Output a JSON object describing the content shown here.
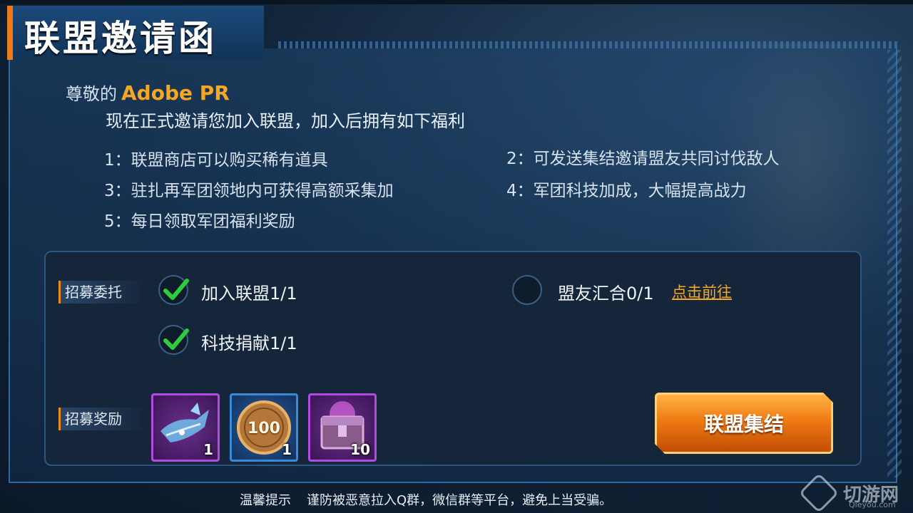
{
  "title": "联盟邀请函",
  "greeting": {
    "label": "尊敬的",
    "name": "Adobe PR"
  },
  "invite_line": "现在正式邀请您加入联盟，加入后拥有如下福利",
  "benefits": [
    "1：联盟商店可以购买稀有道具",
    "2：可发送集结邀请盟友共同讨伐敌人",
    "3：驻扎再军团领地内可获得高额采集加",
    "4：军团科技加成，大幅提高战力",
    "5：每日领取军团福利奖励"
  ],
  "tasks": {
    "section_label": "招募委托",
    "items": [
      {
        "label": "加入联盟1/1",
        "done": true
      },
      {
        "label": "盟友汇合0/1",
        "done": false,
        "link": "点击前往"
      },
      {
        "label": "科技捐献1/1",
        "done": true
      }
    ]
  },
  "rewards": {
    "section_label": "招募奖励",
    "items": [
      {
        "icon": "weapon-part-icon",
        "rarity": "purple",
        "count": "1"
      },
      {
        "icon": "coin-icon",
        "rarity": "blue",
        "coin_value": "100",
        "count": "1"
      },
      {
        "icon": "treasure-chest-icon",
        "rarity": "purple",
        "count": "10"
      }
    ]
  },
  "rally_button": "联盟集结",
  "tip": {
    "label": "温馨提示",
    "text": "谨防被恶意拉入Q群，微信群等平台，避免上当受骗。"
  },
  "watermark": {
    "text": "切游网",
    "sub": "Qieyou.com"
  },
  "colors": {
    "accent": "#f5a623",
    "button": "#f07a12",
    "check": "#2ecc40"
  }
}
